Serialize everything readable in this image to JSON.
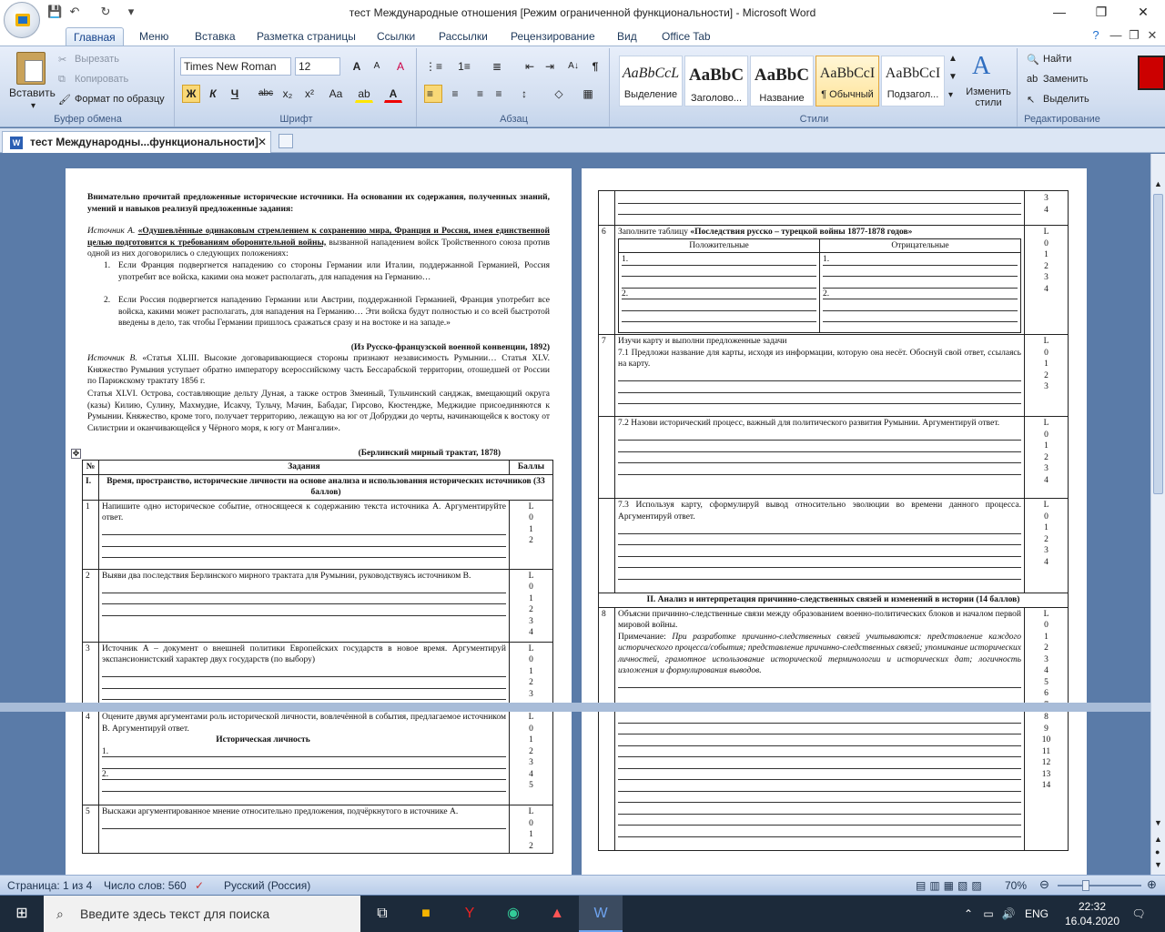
{
  "window": {
    "title": "тест Международные отношения [Режим ограниченной функциональности] - Microsoft Word",
    "minimize": "—",
    "restore": "❐",
    "close": "✕"
  },
  "qat": {
    "save": "💾",
    "undo": "↶",
    "redo": "↻",
    "customize": "▾"
  },
  "ribbon_tabs": [
    "Главная",
    "Меню",
    "Вставка",
    "Разметка страницы",
    "Ссылки",
    "Рассылки",
    "Рецензирование",
    "Вид",
    "Office Tab"
  ],
  "clipboard": {
    "paste": "Вставить",
    "cut": "Вырезать",
    "copy": "Копировать",
    "format_painter": "Формат по образцу",
    "group": "Буфер обмена"
  },
  "font": {
    "family": "Times New Roman",
    "size": "12",
    "group": "Шрифт",
    "bold": "Ж",
    "italic": "К",
    "underline": "Ч",
    "strike": "abc",
    "sub": "x₂",
    "sup": "x²",
    "case": "Aa",
    "grow": "A",
    "shrink": "A",
    "clear": "A",
    "highlight": "ab",
    "color": "A"
  },
  "paragraph": {
    "group": "Абзац",
    "bullets": "⋮≡",
    "numbering": "1≡",
    "multilevel": "≣",
    "outdent": "⇤",
    "indent": "⇥",
    "sort": "A↓",
    "pilcrow": "¶",
    "align_left": "≡",
    "align_center": "≡",
    "align_right": "≡",
    "justify": "≡",
    "spacing": "↕",
    "shading": "◇",
    "borders": "▦"
  },
  "styles": {
    "group": "Стили",
    "items": [
      {
        "preview": "AaBbCcL",
        "name": "Выделение"
      },
      {
        "preview": "AaBbC",
        "name": "Заголово..."
      },
      {
        "preview": "AaBbC",
        "name": "Название"
      },
      {
        "preview": "AaBbCcI",
        "name": "¶ Обычный"
      },
      {
        "preview": "AaBbCcI",
        "name": "Подзагол..."
      }
    ],
    "change": "Изменить стили"
  },
  "editing": {
    "group": "Редактирование",
    "find": "Найти",
    "replace": "Заменить",
    "select": "Выделить"
  },
  "doc_tab": {
    "name": "тест Международны...функциональности]",
    "close": "✕"
  },
  "page1": {
    "intro": "Внимательно прочитай предложенные исторические источники. На основании их содержания, полученных знаний, умений и навыков реализуй предложенные задания:",
    "srcA_label": "Источник А.",
    "srcA_bold": "«Одушевлённые одинаковым стремлением к сохранению мира, Франция и Россия, имея единственной целью подготовится к требованиям оборонительной войны,",
    "srcA_rest": "вызванной нападением войск Тройственного союза против одной из них договорились о следующих положениях:",
    "srcA_item1": "Если Франция подвергнется нападению со стороны Германии или Италии, поддержанной Германией, Россия употребит все войска, какими она может располагать, для нападения на Германию…",
    "srcA_item2": "Если Россия подвергнется нападению Германии или Австрии, поддержанной Германией, Франция употребит все войска, какими может располагать, для нападения на Германию… Эти войска будут полностью и со всей быстротой введены в дело, так чтобы Германии пришлось сражаться сразу и на востоке и на западе.»",
    "srcA_cite": "(Из Русско-французской военной конвенции, 1892)",
    "srcB_label": "Источник В.",
    "srcB_p1": "«Статья XLIII. Высокие договаривающиеся стороны признают независимость Румынии… Статья XLV. Княжество Румыния уступает обратно императору всероссийскому часть Бессарабской территории, отошедшей от России по Парижскому трактату 1856 г.",
    "srcB_p2": "Статья XLVI. Острова, составляющие дельту Дуная, а также остров Змеиный, Тульчинский санджак, вмещающий округа (казы) Килию, Сулину, Махмудие, Исакчу, Тульчу, Мачин, Бабадаг, Гирсово, Кюстендже, Меджидие присоединяются к Румынии. Княжество, кроме того, получает территорию, лежащую на юг от Добруджи до черты, начинающейся к востоку от Силистрии и оканчивающейся у Чёрного моря, к югу от Мангалии».",
    "srcB_cite": "(Берлинский мирный трактат, 1878)",
    "table_head": {
      "num": "№",
      "tasks": "Задания",
      "points": "Баллы"
    },
    "section1": {
      "num": "I.",
      "text": "Время, пространство, исторические личности на основе анализа и использования исторических источников (33 баллов)"
    },
    "rows": [
      {
        "num": "1",
        "text": "Напишите одно историческое событие, относящееся к содержанию текста источника А. Аргументируйте ответ.",
        "score": [
          "L",
          "0",
          "1",
          "2"
        ]
      },
      {
        "num": "2",
        "text": "Выяви два последствия Берлинского мирного трактата для Румынии, руководствуясь источником В.",
        "score": [
          "L",
          "0",
          "1",
          "2",
          "3",
          "4"
        ]
      },
      {
        "num": "3",
        "text": "Источник А – документ о внешней политики Европейских государств в новое время. Аргументируй экспансионистский характер двух государств (по выбору)",
        "score": [
          "L",
          "0",
          "1",
          "2",
          "3"
        ]
      }
    ],
    "rows_b": [
      {
        "num": "4",
        "text": "Оцените двумя аргументами роль исторической личности, вовлечённой в события, предлагаемое источником В. Аргументируй ответ.",
        "sub": "Историческая личность",
        "score": [
          "L",
          "0",
          "1",
          "2",
          "3",
          "4",
          "5"
        ]
      },
      {
        "num": "5",
        "text": "Выскажи аргументированное мнение относительно предложения, подчёркнутого в источнике А.",
        "score": [
          "L",
          "0",
          "1",
          "2"
        ]
      }
    ]
  },
  "page2": {
    "top_score": [
      "3",
      "4"
    ],
    "row6": {
      "num": "6",
      "text_pre": "Заполните таблицу ",
      "text_bold": "«Последствия русско – турецкой войны 1877-1878 годов»",
      "pos": "Положительные",
      "neg": "Отрицательные",
      "n1": "1.",
      "n2": "2.",
      "score": [
        "L",
        "0",
        "1",
        "2",
        "3",
        "4"
      ]
    },
    "row7": {
      "num": "7",
      "text": "Изучи карту и выполни предложенные задачи",
      "t71": "7.1 Предложи название для карты, исходя из информации, которую она несёт. Обоснуй свой ответ, ссылаясь на карту.",
      "score": [
        "L",
        "0",
        "1",
        "2",
        "3"
      ]
    },
    "row72": {
      "text": "7.2 Назови исторический процесс, важный для политического развития Румынии. Аргументируй ответ.",
      "score": [
        "L",
        "0",
        "1",
        "2",
        "3",
        "4"
      ]
    },
    "row73": {
      "text": "7.3 Используя карту, сформулируй вывод относительно эволюции во времени данного процесса. Аргументируй ответ.",
      "score": [
        "L",
        "0",
        "1",
        "2",
        "3",
        "4"
      ]
    },
    "section2": "II. Анализ и интерпретация причинно-следственных связей и изменений в истории (14 баллов)",
    "row8": {
      "num": "8",
      "text": "Объясни причинно-следственные связи между образованием военно-политических блоков и началом первой мировой войны.",
      "note_label": "Примечание:",
      "note": "При разработке причинно-следственных связей учитываются: представление каждого исторического процесса/события; представление причинно-следственных связей; упоминание исторических личностей, грамотное использование исторической терминологии и исторических дат; логичность изложения и формулирования выводов.",
      "score": [
        "L",
        "0",
        "1",
        "2",
        "3",
        "4",
        "5",
        "6",
        "7"
      ],
      "score_b": [
        "8",
        "9",
        "10",
        "11",
        "12",
        "13",
        "14"
      ]
    }
  },
  "status": {
    "page": "Страница: 1 из 4",
    "words": "Число слов: 560",
    "lang": "Русский (Россия)",
    "zoom": "70%",
    "zoom_level": 0.7
  },
  "taskbar": {
    "search": "Введите здесь текст для поиска",
    "time": "22:32",
    "date": "16.04.2020",
    "lang": "ENG"
  }
}
